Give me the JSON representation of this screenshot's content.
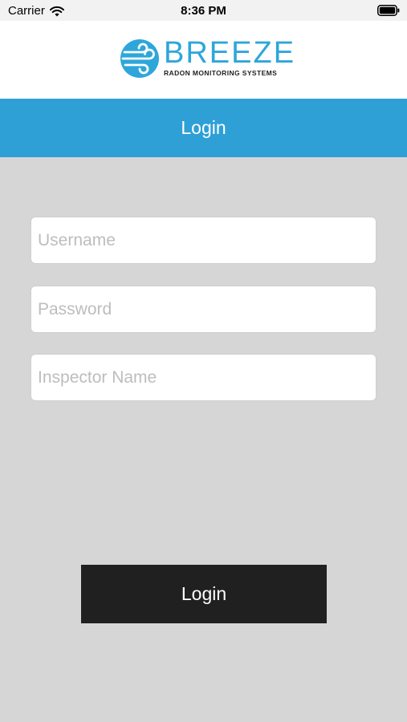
{
  "status_bar": {
    "carrier": "Carrier",
    "time": "8:36 PM",
    "icons": [
      "wifi-icon",
      "battery-icon"
    ]
  },
  "brand": {
    "name": "BREEZE",
    "tagline": "RADON MONITORING SYSTEMS",
    "logo_icon": "wind-swirl-icon",
    "color": "#2ea6da"
  },
  "nav": {
    "title": "Login",
    "color": "#2ea0d6"
  },
  "form": {
    "username": {
      "value": "",
      "placeholder": "Username"
    },
    "password": {
      "value": "",
      "placeholder": "Password"
    },
    "inspector": {
      "value": "",
      "placeholder": "Inspector Name"
    }
  },
  "actions": {
    "login_label": "Login",
    "login_color": "#202020"
  },
  "colors": {
    "background": "#d6d6d6"
  }
}
